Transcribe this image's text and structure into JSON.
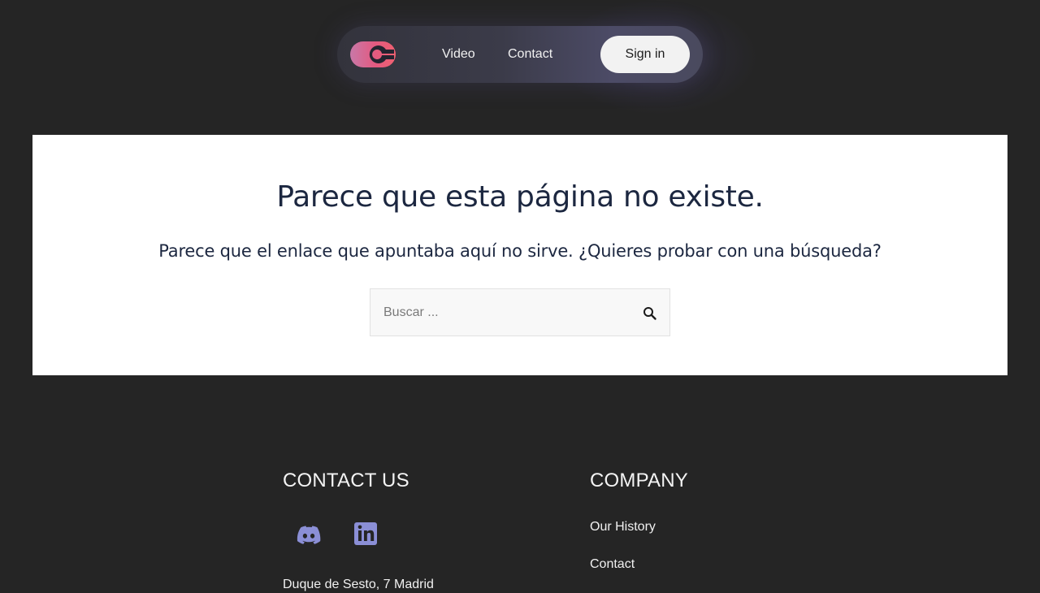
{
  "nav": {
    "logo_icon": "brand-logo-icon",
    "links": [
      "Video",
      "Contact"
    ],
    "signin_label": "Sign in"
  },
  "main": {
    "title": "Parece que esta página no existe.",
    "subtitle": "Parece que el enlace que apuntaba aquí no sirve. ¿Quieres probar con una búsqueda?",
    "search": {
      "placeholder": "Buscar ...",
      "value": "",
      "icon": "search-icon"
    }
  },
  "footer": {
    "contact": {
      "heading": "CONTACT US",
      "social_icons": [
        "discord-icon",
        "linkedin-icon"
      ],
      "address": "Duque de Sesto, 7 Madrid"
    },
    "company": {
      "heading": "COMPANY",
      "links": [
        "Our History",
        "Contact"
      ]
    }
  },
  "colors": {
    "page_bg": "#252525",
    "card_bg": "#ffffff",
    "heading_text": "#1c2740",
    "social_icon": "#8b8fd6",
    "signin_bg": "#f2f2f2"
  }
}
